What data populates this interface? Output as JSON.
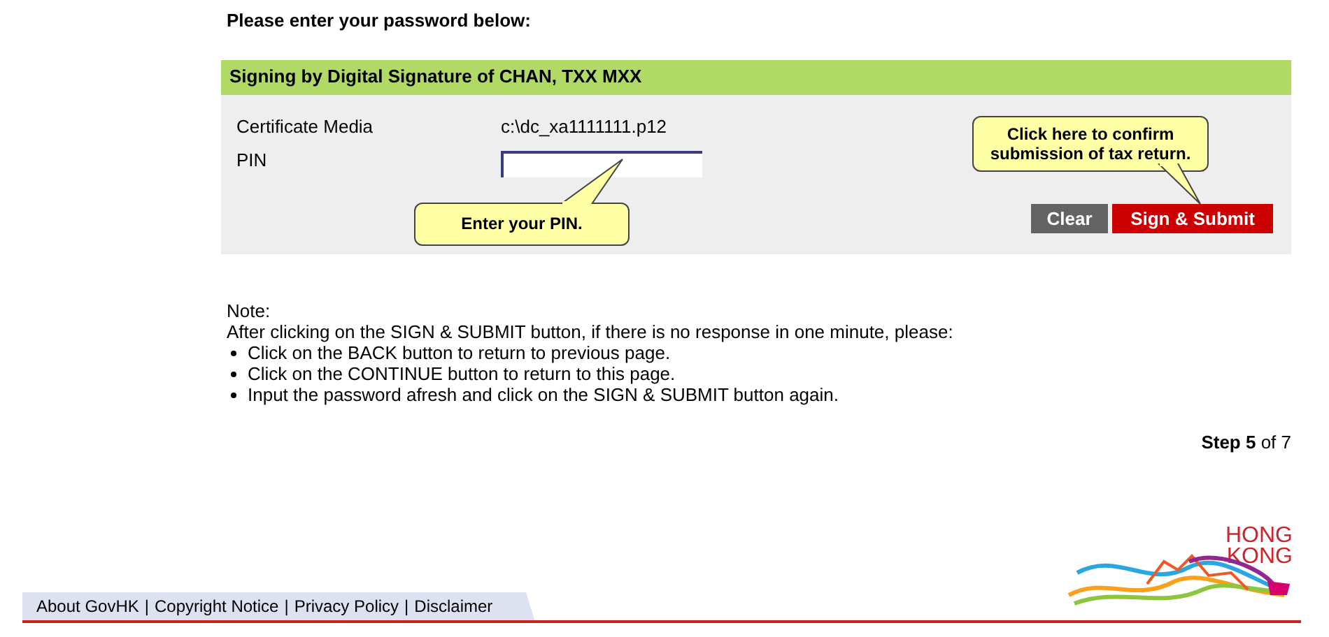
{
  "heading": "Please enter your password below:",
  "panel": {
    "title": "Signing by Digital Signature of CHAN, TXX MXX",
    "fields": [
      {
        "kind": "text",
        "label": "Certificate Media",
        "value": "c:\\dc_xa1111111.p12"
      },
      {
        "kind": "input",
        "label": "PIN"
      }
    ],
    "pin_callout": "Enter your PIN.",
    "submit_callout": [
      "Click here to confirm",
      "submission of tax return."
    ],
    "buttons": [
      {
        "kind": "clear",
        "label": "Clear"
      },
      {
        "kind": "submit",
        "label": "Sign & Submit"
      }
    ]
  },
  "note": {
    "title": "Note:",
    "intro": "After clicking on the SIGN & SUBMIT button, if there is no response in one minute, please:",
    "items": [
      "Click on the BACK button to return to previous page.",
      "Click on the CONTINUE button to return to this page.",
      "Input the password afresh and click on the SIGN & SUBMIT button again."
    ]
  },
  "step": "**Step 5** of 7",
  "footer": {
    "links": [
      {
        "label": "About GovHK"
      },
      {
        "label": "Copyright Notice"
      },
      {
        "label": "Privacy Policy"
      },
      {
        "label": "Disclaimer"
      }
    ],
    "separators": [
      "|",
      "|",
      "|"
    ]
  },
  "logo": [
    "HONG",
    "KONG"
  ]
}
